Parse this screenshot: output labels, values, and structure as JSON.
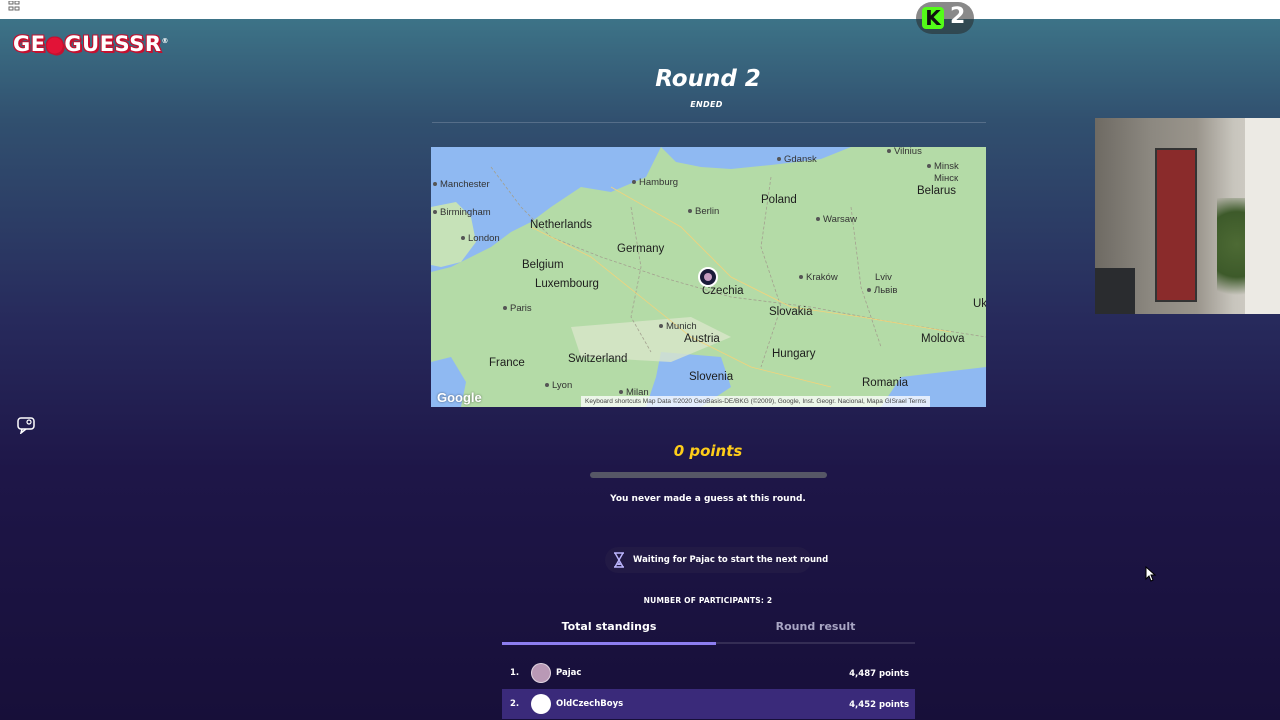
{
  "top_bar": {
    "grid_icon": "grid-icon",
    "stream_badge": {
      "letter": "K",
      "count": "2"
    }
  },
  "logo": {
    "text_left": "GE",
    "text_right": "GUESSR",
    "registered": "®"
  },
  "round": {
    "title": "Round 2",
    "status": "ENDED"
  },
  "map": {
    "countries": {
      "netherlands": "Netherlands",
      "germany": "Germany",
      "poland": "Poland",
      "belarus": "Belarus",
      "belgium": "Belgium",
      "luxembourg": "Luxembourg",
      "czechia": "Czechia",
      "slovakia": "Slovakia",
      "austria": "Austria",
      "hungary": "Hungary",
      "switzerland": "Switzerland",
      "france": "France",
      "slovenia": "Slovenia",
      "romania": "Romania",
      "moldova": "Moldova",
      "ukraine_partial": "Uk"
    },
    "cities": {
      "manchester": "Manchester",
      "birmingham": "Birmingham",
      "london": "London",
      "hamburg": "Hamburg",
      "gdansk": "Gdansk",
      "vilnius": "Vilnius",
      "minsk": "Minsk",
      "minsk_cyr": "Мінск",
      "berlin": "Berlin",
      "warsaw": "Warsaw",
      "krakow": "Kraków",
      "lviv": "Lviv",
      "lviv_cyr": "Львів",
      "paris": "Paris",
      "munich": "Munich",
      "lyon": "Lyon",
      "milan": "Milan"
    },
    "google": "Google",
    "footer": "Keyboard shortcuts   Map Data ©2020 GeoBasis-DE/BKG (©2009), Google, Inst. Geogr. Nacional, Mapa GISrael   Terms"
  },
  "result": {
    "points": "0 points",
    "progress_fraction": 0,
    "message": "You never made a guess at this round."
  },
  "waiting": {
    "text": "Waiting for Pajac to start the next round",
    "icon": "hourglass-icon"
  },
  "participants": "NUMBER OF PARTICIPANTS: 2",
  "tabs": {
    "total": "Total standings",
    "round": "Round result"
  },
  "standings": [
    {
      "rank": "1.",
      "name": "Pajac",
      "score": "4,487 points"
    },
    {
      "rank": "2.",
      "name": "OldCzechBoys",
      "score": "4,452 points"
    }
  ],
  "colors": {
    "points": "#fecd19",
    "accent": "#8d7ef0",
    "logo_red": "#e21337",
    "kick_green": "#53fc18"
  }
}
